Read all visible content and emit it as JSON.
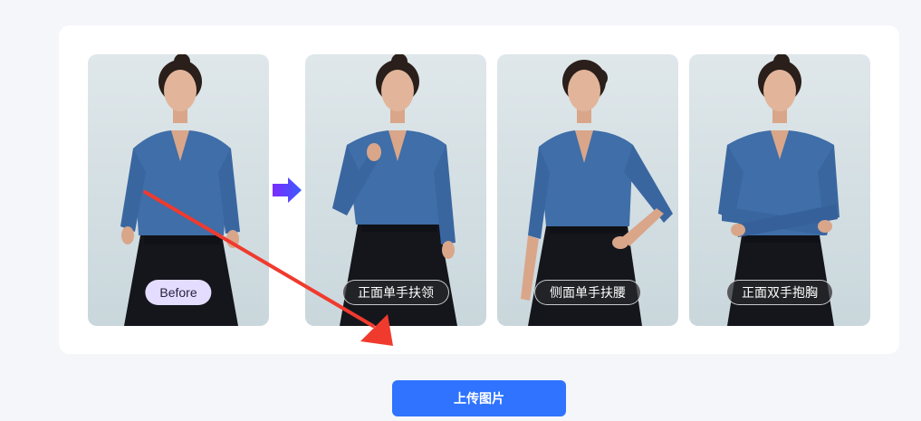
{
  "photos": [
    {
      "label": "Before",
      "style": "before",
      "pose": "standing"
    },
    {
      "label": "正面单手扶领",
      "style": "dark",
      "pose": "hand-collar"
    },
    {
      "label": "侧面单手扶腰",
      "style": "dark",
      "pose": "hand-waist"
    },
    {
      "label": "正面双手抱胸",
      "style": "dark",
      "pose": "arms-crossed"
    }
  ],
  "upload_button": {
    "label": "上传图片"
  },
  "colors": {
    "page_bg": "#f4f6f9",
    "card_bg": "#ffffff",
    "accent": "#2f73ff",
    "before_badge": "#e4ddff",
    "annotation_arrow": "#f03a2e",
    "transform_arrow_start": "#7a2cff",
    "transform_arrow_end": "#3a5bff",
    "blouse": "#3f6ea8",
    "skirt": "#14161c"
  },
  "icons": {
    "transform_arrow": "arrow-right-icon",
    "annotation": "annotation-arrow"
  }
}
